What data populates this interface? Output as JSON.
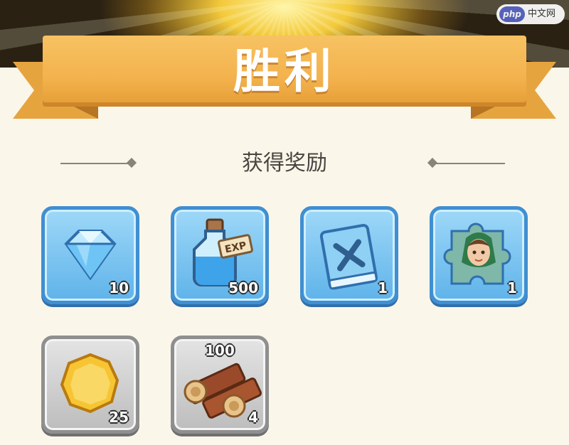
{
  "header": {
    "title": "胜利"
  },
  "rewards_section": {
    "title": "获得奖励"
  },
  "rewards": [
    {
      "icon": "diamond-icon",
      "count": "10",
      "style": "blue"
    },
    {
      "icon": "exp-potion-icon",
      "count": "500",
      "style": "blue",
      "label": "EXP"
    },
    {
      "icon": "skill-book-icon",
      "count": "1",
      "style": "blue"
    },
    {
      "icon": "hero-puzzle-fragment-icon",
      "count": "1",
      "style": "blue"
    },
    {
      "icon": "gold-coin-icon",
      "count": "25",
      "style": "gray"
    },
    {
      "icon": "wood-logs-icon",
      "count": "4",
      "top_count": "100",
      "style": "gray"
    }
  ],
  "watermark": {
    "logo": "php",
    "text": "中文网"
  },
  "colors": {
    "banner": "#f3b24d",
    "blue_tile": "#5fb3ea",
    "gray_tile": "#bdbdbd",
    "background": "#fbf6ea"
  }
}
